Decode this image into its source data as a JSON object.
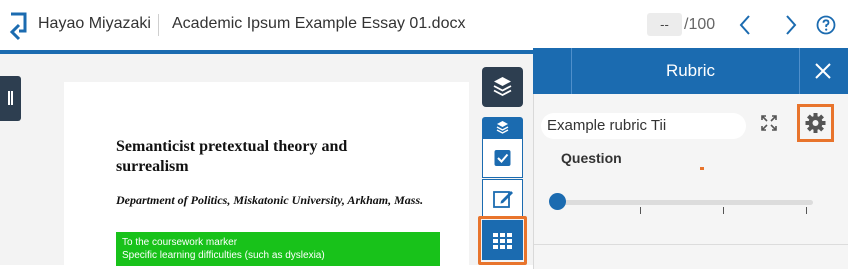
{
  "header": {
    "author": "Hayao Miyazaki",
    "document_title": "Academic Ipsum Example Essay 01.docx",
    "score_value": "--",
    "score_total": "/100",
    "prev_icon": "chevron-left-icon",
    "next_icon": "chevron-right-icon",
    "help_icon": "help-circle-icon"
  },
  "document": {
    "title": "Semanticist pretextual theory and surrealism",
    "department": "Department of Politics, Miskatonic University, Arkham, Mass.",
    "note_line1": "To the coursework marker",
    "note_line2": "Specific learning difficulties (such as dyslexia)"
  },
  "tools": {
    "layers_icon": "layers-icon",
    "grading_icon": "checkbox-icon",
    "comment_icon": "edit-icon",
    "rubric_icon": "grid-icon"
  },
  "rubric_panel": {
    "title": "Rubric",
    "rubric_name": "Example rubric Tii",
    "question_label": "Question",
    "slider_value": 0
  },
  "colors": {
    "brand_blue": "#1b6bb0",
    "dark_navy": "#2d3e50",
    "highlight_orange": "#e8742c",
    "note_green": "#18c21a"
  }
}
